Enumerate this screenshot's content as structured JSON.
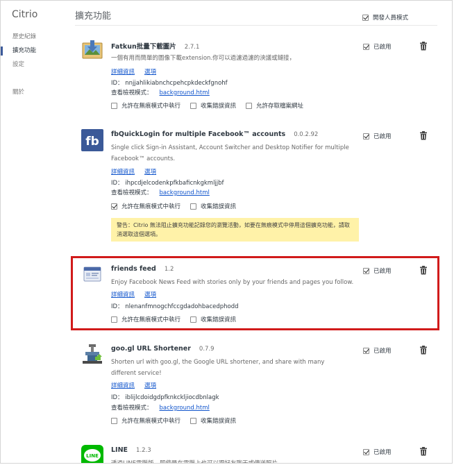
{
  "sidebar": {
    "brand": "Citrio",
    "items": [
      {
        "label": "歷史紀錄"
      },
      {
        "label": "擴充功能"
      },
      {
        "label": "設定"
      },
      {
        "label": "關於"
      }
    ]
  },
  "header": {
    "title": "擴充功能",
    "dev_mode_label": "開發人員模式",
    "dev_mode_checked": false
  },
  "common": {
    "enabled_label": "已啟用",
    "details_link": "詳細資訊",
    "options_link": "選項",
    "view_label": "查看檢視模式：",
    "incognito_label": "允許在無痕模式中執行",
    "errors_label": "收集錯誤資訊",
    "file_access_label": "允許存取檔案網址"
  },
  "extensions": [
    {
      "name": "Fatkun批量下載圖片",
      "version": "2.7.1",
      "description": "一個有用而簡單的圖像下載extension.你可以過濾過濾的泱議或鏈接，",
      "id_text": "ID： nnjjahlikiabnchcpehcpkdeckfgnohf",
      "background": "background.html",
      "incognito_checked": false,
      "errors_checked": false,
      "file_access_checked": false,
      "icon": "download-images-icon"
    },
    {
      "name": "fbQuickLogin for multiple Facebook™ accounts",
      "version": "0.0.2.92",
      "description": "Single click Sign-in Assistant, Account Switcher and Desktop Notifier for multiple Facebook™ accounts.",
      "id_text": "ID： ihpcdjelcodenkpfkbaficnkgkmljjbf",
      "background": "background.html",
      "incognito_checked": true,
      "errors_checked": false,
      "warning": "警告：Citrio 無法阻止擴充功能記錄您的瀏覽活動，如要在無痕模式中停用這個擴充功能，請取消選取這個選項。",
      "icon": "fb-icon"
    },
    {
      "name": "friends feed",
      "version": "1.2",
      "description": "Enjoy Facebook News Feed with stories only by your friends and pages you follow.",
      "id_text": "ID： nlenanfmnogchfccgdadohbacedphodd",
      "incognito_checked": false,
      "errors_checked": false,
      "icon": "friends-feed-icon"
    },
    {
      "name": "goo.gl URL Shortener",
      "version": "0.7.9",
      "description": "Shorten url with goo.gl, the Google URL shortener, and share with many different service!",
      "id_text": "ID： iblijlcdoidgdpfknkckljiocdbnlagk",
      "background": "background.html",
      "incognito_checked": false,
      "errors_checked": false,
      "icon": "vise-icon"
    },
    {
      "name": "LINE",
      "version": "1.2.3",
      "description": "透過LINE電腦版，即使是在電腦上也可以跟好友聊天或傳送照片",
      "icon": "line-icon"
    }
  ],
  "colors": {
    "highlight_border": "#d11a1a",
    "link": "#1155cc",
    "warning_bg": "#fff2a8",
    "fb_blue": "#3b5998",
    "line_green": "#00b900"
  }
}
